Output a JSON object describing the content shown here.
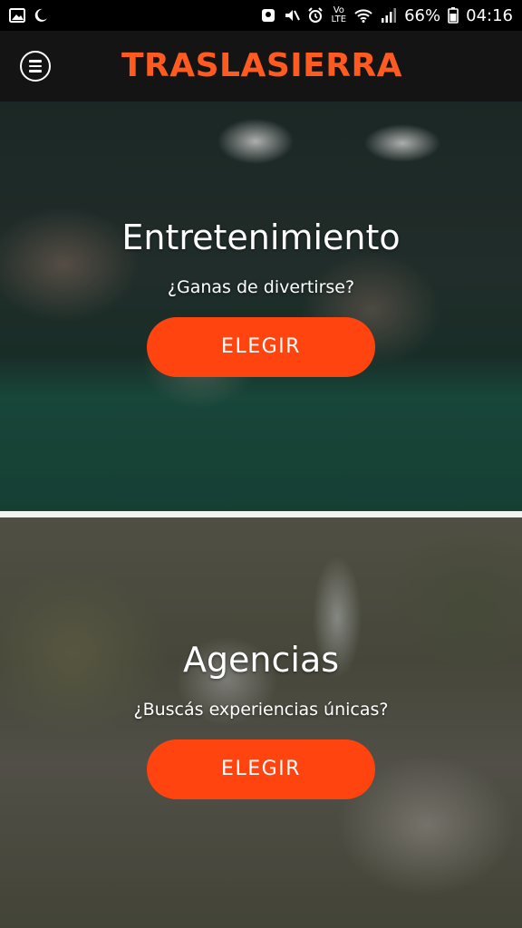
{
  "status_bar": {
    "left_icons": [
      "image-icon",
      "moon-icon"
    ],
    "right_icons": [
      "notification-icon",
      "mute-icon",
      "alarm-icon",
      "volte-icon",
      "wifi-icon",
      "signal-icon",
      "battery-icon"
    ],
    "volte_top": "Vo",
    "volte_bottom": "LTE",
    "battery": "66%",
    "time": "04:16"
  },
  "app_bar": {
    "menu_icon": "menu-icon",
    "title": "TRASLASIERRA",
    "title_color": "#ff5a1f"
  },
  "cards": [
    {
      "title": "Entretenimiento",
      "subtitle": "¿Ganas de divertirse?",
      "button_label": "ELEGIR",
      "background": "billiards-photo"
    },
    {
      "title": "Agencias",
      "subtitle": "¿Buscás experiencias únicas?",
      "button_label": "ELEGIR",
      "background": "zipline-photo"
    }
  ],
  "colors": {
    "accent": "#ff4410",
    "app_bar": "#141414",
    "status_bar": "#000000"
  }
}
